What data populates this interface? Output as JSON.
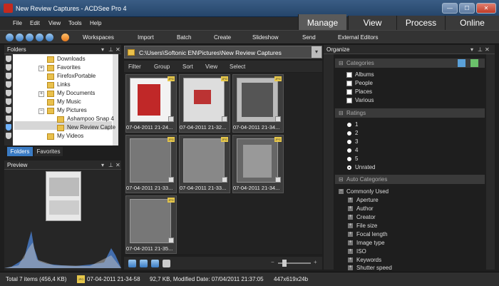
{
  "window": {
    "title": "New Review Captures - ACDSee Pro 4",
    "min": "—",
    "max": "☐",
    "close": "✕"
  },
  "menu": {
    "file": "File",
    "edit": "Edit",
    "view": "View",
    "tools": "Tools",
    "help": "Help"
  },
  "modes": {
    "manage": "Manage",
    "view": "View",
    "process": "Process",
    "online": "Online"
  },
  "toolbar": {
    "workspaces": "Workspaces",
    "import": "Import",
    "batch": "Batch",
    "create": "Create",
    "slideshow": "Slideshow",
    "send": "Send",
    "external_editors": "External Editors"
  },
  "folders_panel": {
    "title": "Folders",
    "items": [
      "Downloads",
      "Favorites",
      "FirefoxPortable",
      "Links",
      "My Documents",
      "My Music",
      "My Pictures",
      "Ashampoo Snap 4",
      "New Review Capte",
      "My Videos"
    ],
    "tabs": {
      "folders": "Folders",
      "favorites": "Favorites"
    }
  },
  "preview_panel": {
    "title": "Preview"
  },
  "browser": {
    "path": "C:\\Users\\Softonic EN\\Pictures\\New Review Captures",
    "filters": {
      "filter": "Filter",
      "group": "Group",
      "sort": "Sort",
      "view": "View",
      "select": "Select"
    },
    "thumbnails": [
      {
        "label": "07-04-2011 21-24...",
        "badge": "JPG"
      },
      {
        "label": "07-04-2011 21-32...",
        "badge": "JPG"
      },
      {
        "label": "07-04-2011 21-34...",
        "badge": "JPG"
      },
      {
        "label": "07-04-2011 21-33...",
        "badge": "JPG"
      },
      {
        "label": "07-04-2011 21-33...",
        "badge": "JPG"
      },
      {
        "label": "07-04-2011 21-34...",
        "badge": "JPG"
      },
      {
        "label": "07-04-2011 21-35...",
        "badge": "JPG"
      }
    ]
  },
  "organize": {
    "title": "Organize",
    "categories_header": "Categories",
    "categories": [
      "Albums",
      "People",
      "Places",
      "Various"
    ],
    "ratings_header": "Ratings",
    "ratings": [
      "1",
      "2",
      "3",
      "4",
      "5",
      "Unrated"
    ],
    "auto_header": "Auto Categories",
    "commonly_used": "Commonly Used",
    "auto_items": [
      "Aperture",
      "Author",
      "Creator",
      "File size",
      "Focal length",
      "Image type",
      "ISO",
      "Keywords",
      "Shutter speed"
    ]
  },
  "status": {
    "total": "Total 7 items  (456,4 KB)",
    "badge": "JPG",
    "file": "07-04-2011 21-34-58",
    "info": "92,7 KB, Modified Date: 07/04/2011 21:37:05",
    "dims": "447x619x24b"
  },
  "colors": {
    "accent": "#3a7bc4",
    "selection": "#cfcfcf",
    "folder": "#e9c04c"
  }
}
